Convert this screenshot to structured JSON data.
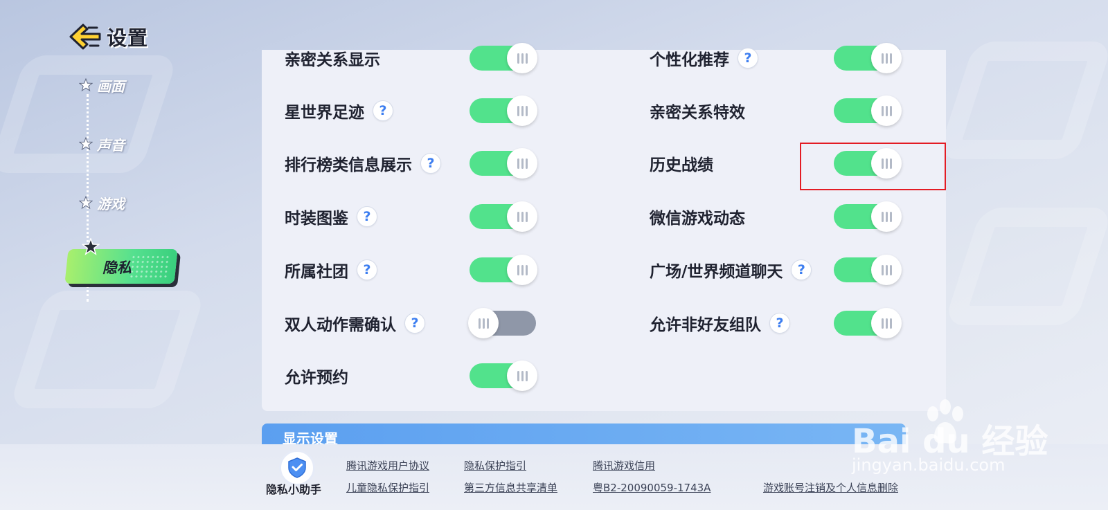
{
  "header": {
    "title": "设置"
  },
  "nav": {
    "items": [
      {
        "label": "画面"
      },
      {
        "label": "声音"
      },
      {
        "label": "游戏"
      },
      {
        "label": "隐私"
      }
    ]
  },
  "settings": {
    "left": [
      {
        "label": "亲密关系显示",
        "help": false,
        "on": true
      },
      {
        "label": "星世界足迹",
        "help": true,
        "on": true
      },
      {
        "label": "排行榜类信息展示",
        "help": true,
        "on": true
      },
      {
        "label": "时装图鉴",
        "help": true,
        "on": true
      },
      {
        "label": "所属社团",
        "help": true,
        "on": true
      },
      {
        "label": "双人动作需确认",
        "help": true,
        "on": false
      },
      {
        "label": "允许预约",
        "help": false,
        "on": true
      }
    ],
    "right": [
      {
        "label": "个性化推荐",
        "help": true,
        "on": true
      },
      {
        "label": "亲密关系特效",
        "help": false,
        "on": true
      },
      {
        "label": "历史战绩",
        "help": false,
        "on": true
      },
      {
        "label": "微信游戏动态",
        "help": false,
        "on": true
      },
      {
        "label": "广场/世界频道聊天",
        "help": true,
        "on": true
      },
      {
        "label": "允许非好友组队",
        "help": true,
        "on": true
      }
    ],
    "help_glyph": "?"
  },
  "section": {
    "title": "显示设置"
  },
  "footer": {
    "assistant_label": "隐私小助手",
    "links": {
      "user_agreement": "腾讯游戏用户协议",
      "child_privacy": "儿童隐私保护指引",
      "privacy_guide": "隐私保护指引",
      "third_party": "第三方信息共享清单",
      "credit": "腾讯游戏信用",
      "license": "粤B2-20090059-1743A",
      "account_cancel": "游戏账号注销及个人信息删除"
    }
  },
  "watermark": {
    "brand": "Bai du 经验",
    "url": "jingyan.baidu.com"
  },
  "colors": {
    "toggle_on": "#52e28c",
    "toggle_off": "#8f97a8",
    "highlight": "#e31c24",
    "nav_active": "#55e08f",
    "section_bar": "#5b9ff0"
  }
}
